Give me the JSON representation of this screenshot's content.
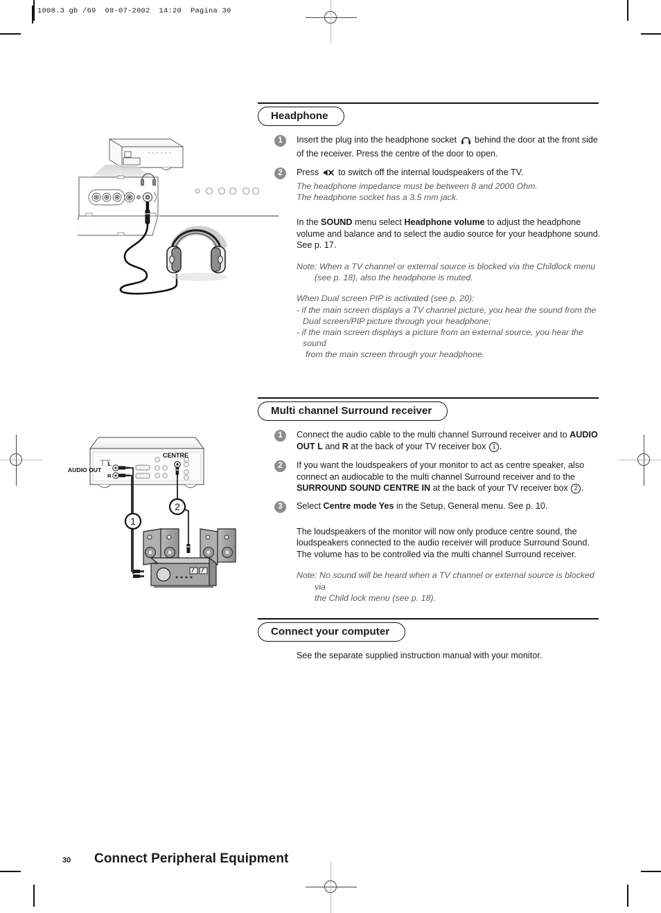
{
  "page": {
    "file_stamp": "1008.3 gb /69  08-07-2002  14:20  Pagina 30",
    "page_number": "30",
    "footer_title": "Connect Peripheral Equipment"
  },
  "sections": {
    "headphone": {
      "title": "Headphone",
      "steps": [
        {
          "num": "1",
          "text_before_icon": "Insert the plug into the headphone socket ",
          "icon": "headphone-icon",
          "text_after_icon": " behind the door at the front side of the receiver. Press the centre of the door to open."
        },
        {
          "num": "2",
          "text_before_icon": "Press ",
          "icon": "mute-speaker-icon",
          "text_after_icon": " to switch off the internal loudspeakers of the TV.",
          "sub_lines": [
            "The headphone impedance must be between 8 and 2000 Ohm.",
            "The headphone socket has a 3.5 mm jack."
          ]
        }
      ],
      "sound_paragraph": {
        "p1": "In the ",
        "bold1": "SOUND",
        "p2": " menu select ",
        "bold2": "Headphone volume",
        "p3": " to adjust the headphone volume and balance and to select the audio source for your headphone sound. See p. 17."
      },
      "note": {
        "line1": "Note: When a TV channel or external source is blocked via the Childlock menu",
        "line2": "(see p. 18), also the headphone is muted."
      },
      "pip_note": {
        "line1": "When Dual screen PIP is activated (see p. 20):",
        "line2": "- if the main screen displays a TV channel picture, you hear the sound from the",
        "line3": "Dual screen/PIP picture through your headphone;",
        "line4": "- if the main screen displays a picture from an external source, you hear the sound",
        "line5": "from the main screen through your headphone."
      }
    },
    "surround": {
      "title": "Multi channel Surround receiver",
      "steps": [
        {
          "num": "1",
          "t1": "Connect the audio cable to the multi channel Surround receiver and to ",
          "b1": "AUDIO OUT L",
          "t2": " and ",
          "b2": "R",
          "t3": " at the back of your TV receiver box ",
          "circled": "1",
          "t4": "."
        },
        {
          "num": "2",
          "t1": "If you want the loudspeakers of your monitor to act as centre speaker, also connect an audiocable to the multi channel Surround receiver and to the ",
          "b1": "SURROUND SOUND CENTRE IN",
          "t2": " at the back of your TV receiver box ",
          "circled": "2",
          "t3": "."
        },
        {
          "num": "3",
          "t1": "Select ",
          "b1": "Centre mode Yes",
          "t2": " in the Setup, General menu. See p. 10."
        }
      ],
      "paragraph": "The loudspeakers of the monitor will now only produce centre sound, the loudspeakers connected to the audio receiver will produce Surround Sound. The volume has to be controlled via the multi channel Surround receiver.",
      "note": {
        "line1": "Note: No sound will be heard when a TV channel or external source is blocked via",
        "line2": "the Child lock menu (see p. 18)."
      }
    },
    "computer": {
      "title": "Connect your computer",
      "paragraph": "See the separate supplied instruction manual with your monitor."
    }
  },
  "figures": {
    "headphone_diagram": {
      "name": "headphone-connection-diagram"
    },
    "surround_diagram": {
      "name": "surround-receiver-connection-diagram",
      "label_audio_out": "AUDIO OUT",
      "label_l": "L",
      "label_r": "R",
      "label_centre": "CENTRE",
      "callout_1": "1",
      "callout_2": "2"
    }
  },
  "colors": {
    "ink": "#1a1a1a",
    "italic_gray": "#5a5a5a",
    "bullet_gray": "#8c8c8c",
    "device_gray": "#9a9a9a"
  }
}
